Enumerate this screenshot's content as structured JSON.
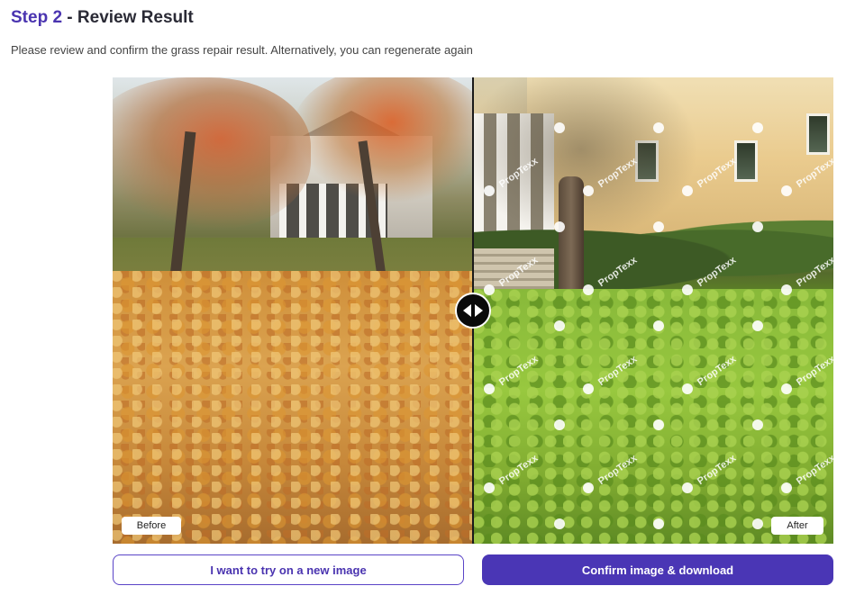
{
  "header": {
    "step": "Step 2",
    "separator": " - ",
    "title": "Review Result",
    "description": "Please review and confirm the grass repair result. Alternatively, you can regenerate again"
  },
  "comparison": {
    "before_label": "Before",
    "after_label": "After",
    "watermark": "PropTexx",
    "slider_position": 0.5
  },
  "actions": {
    "new_image_label": "I want to try on a new image",
    "confirm_label": "Confirm image & download"
  },
  "colors": {
    "accent": "#4a36b5",
    "step_text": "#4a34b0"
  },
  "icons": {
    "slider": "left-right-arrows-icon"
  }
}
